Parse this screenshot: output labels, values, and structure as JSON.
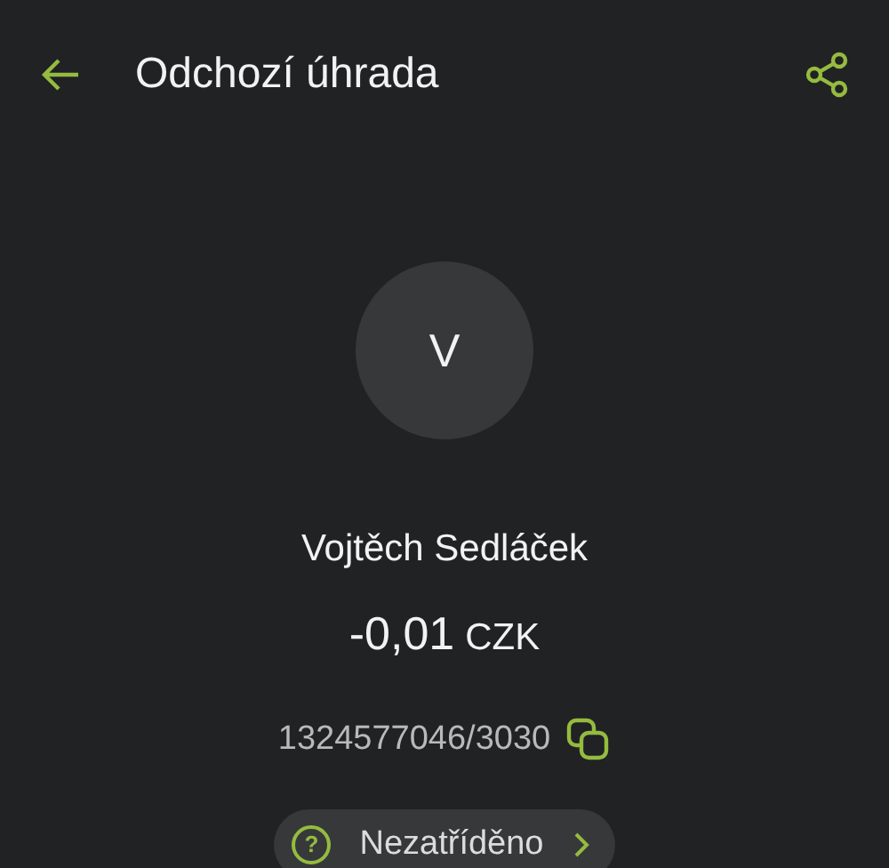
{
  "header": {
    "title": "Odchozí úhrada"
  },
  "avatar": {
    "initial": "V"
  },
  "counterparty": {
    "name": "Vojtěch Sedláček"
  },
  "amount": {
    "value": "-0,01",
    "currency": "CZK"
  },
  "account": {
    "number": "1324577046/3030"
  },
  "category": {
    "icon": "?",
    "label": "Nezatříděno"
  }
}
